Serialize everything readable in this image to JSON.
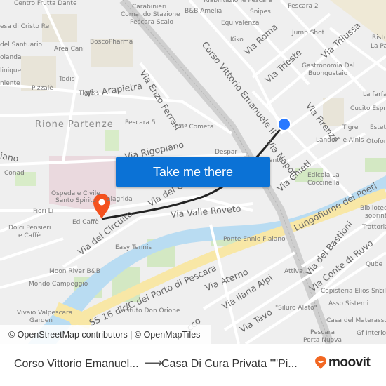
{
  "map": {
    "district_labels": [
      {
        "text": "Rione Partenze"
      }
    ],
    "road_labels": [
      {
        "text": "Via Arapietra"
      },
      {
        "text": "Via Enzo Ferrari"
      },
      {
        "text": "Corso Vittorio Emanuele II"
      },
      {
        "text": "Via Roma"
      },
      {
        "text": "Via Trieste"
      },
      {
        "text": "Via Trilussa"
      },
      {
        "text": "Via Firenze"
      },
      {
        "text": "Via Napoli"
      },
      {
        "text": "Via Chieti"
      },
      {
        "text": "Via Rigopiano"
      },
      {
        "text": "Via del Circuito"
      },
      {
        "text": "Via del Circuito"
      },
      {
        "text": "Via Valle Roveto"
      },
      {
        "text": "Lungofiume dei Poeti"
      },
      {
        "text": "SS 16 dir/C del Porto di Pescara"
      },
      {
        "text": "Via Aterno"
      },
      {
        "text": "Via Ilaria Alpi"
      },
      {
        "text": "Via Tavo"
      },
      {
        "text": "Via dei Bastioni"
      },
      {
        "text": "Via Conte di Ruvo"
      },
      {
        "text": "iano"
      },
      {
        "text": "cco"
      }
    ],
    "poi_labels": [
      {
        "text": "Centro Frutta Dante"
      },
      {
        "text": "esa di Cristo Re"
      },
      {
        "text": "del Santuario"
      },
      {
        "text": "olanda"
      },
      {
        "text": "linique"
      },
      {
        "text": "niente"
      },
      {
        "text": "Area Cani"
      },
      {
        "text": "BoscoPharma"
      },
      {
        "text": "Todis"
      },
      {
        "text": "Pizzalè"
      },
      {
        "text": "Tigre"
      },
      {
        "text": "Carabinieri"
      },
      {
        "text": "Comando Stazione"
      },
      {
        "text": "Pescara Scalo"
      },
      {
        "text": "Riabilitazione Pescara"
      },
      {
        "text": "B&B Amelia"
      },
      {
        "text": "Snipes"
      },
      {
        "text": "Pescara 2"
      },
      {
        "text": "Equivalenza"
      },
      {
        "text": "Kiko"
      },
      {
        "text": "Jump Shot"
      },
      {
        "text": "Risto"
      },
      {
        "text": "La Pa"
      },
      {
        "text": "Gastronomia Dal"
      },
      {
        "text": "Buongustaio"
      },
      {
        "text": "La farfal"
      },
      {
        "text": "Cucito Espres"
      },
      {
        "text": "Tigre"
      },
      {
        "text": "Estetic"
      },
      {
        "text": "Landolfi e Alnis"
      },
      {
        "text": "Otofon"
      },
      {
        "text": "Pescara 5"
      },
      {
        "text": "L'8ª Cometa"
      },
      {
        "text": "Despar"
      },
      {
        "text": "anto"
      },
      {
        "text": "Edicola La"
      },
      {
        "text": "Coccinella"
      },
      {
        "text": "Conad"
      },
      {
        "text": "Ospedale Civile"
      },
      {
        "text": "Santo Spirito"
      },
      {
        "text": "alagrida"
      },
      {
        "text": "Fiori Li"
      },
      {
        "text": "Ed Caffè"
      },
      {
        "text": "Dolci Pensieri"
      },
      {
        "text": "e Caffè"
      },
      {
        "text": "Easy Tennis"
      },
      {
        "text": "Moon River B&B"
      },
      {
        "text": "Mondo Campeggio"
      },
      {
        "text": "Vivaio Valpescara"
      },
      {
        "text": "Garden"
      },
      {
        "text": "Istituto Don Orione"
      },
      {
        "text": "Ponte Ennio Flaiano"
      },
      {
        "text": "Attiva"
      },
      {
        "text": "\"Siluro Alato\""
      },
      {
        "text": "Copisteria Elios Snc"
      },
      {
        "text": "Lil"
      },
      {
        "text": "Asso Sistemi"
      },
      {
        "text": "Casa del Materasso"
      },
      {
        "text": "Pescara"
      },
      {
        "text": "Porta Nuova"
      },
      {
        "text": "Gf Interior"
      },
      {
        "text": "Biblioteca"
      },
      {
        "text": "soprint"
      },
      {
        "text": "Trattoria"
      },
      {
        "text": "Qube"
      }
    ],
    "origin_marker": {
      "label": "origin-dot",
      "color": "#2979ff"
    },
    "destination_marker": {
      "label": "destination-pin",
      "color": "#f4511e"
    },
    "route_color": "#222222"
  },
  "cta": {
    "label": "Take me there",
    "color": "#0b72d6"
  },
  "attribution": {
    "text": "© OpenStreetMap contributors | © OpenMapTiles"
  },
  "footer": {
    "from": "Corso Vittorio Emanuel...",
    "arrow": "⟶",
    "to": "Casa Di Cura Privata \"\"Pi...",
    "brand": "moovit",
    "brand_color": "#f26722"
  }
}
